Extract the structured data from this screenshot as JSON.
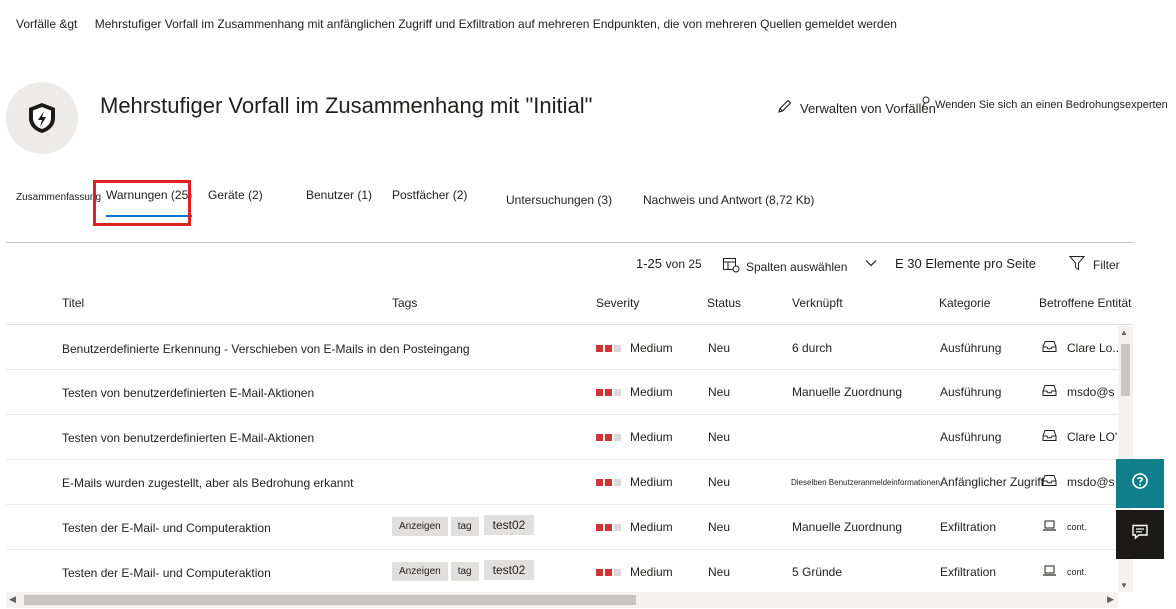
{
  "breadcrumb": {
    "root": "Vorfälle &gt",
    "current": "Mehrstufiger Vorfall im Zusammenhang mit anfänglichen Zugriff und Exfiltration auf mehreren Endpunkten, die von mehreren Quellen gemeldet werden"
  },
  "header": {
    "title": "Mehrstufiger Vorfall im Zusammenhang mit \"Initial\"",
    "icon": "shield-lightning-icon",
    "manage_label": "Verwalten von Vorfällen",
    "expert_label": "Wenden Sie sich an einen Bedrohungsexperten"
  },
  "tabs": [
    {
      "label": "Zusammenfassung"
    },
    {
      "label": "Warnungen (25)",
      "selected": true
    },
    {
      "label": "Geräte (2)"
    },
    {
      "label": "Benutzer (1)"
    },
    {
      "label": "Postfächer (2)"
    },
    {
      "label": "Untersuchungen (3)"
    },
    {
      "label": "Nachweis und Antwort (8,72 Kb)"
    }
  ],
  "toolbar": {
    "range": "1-25",
    "of_total": "von 25",
    "columns_label": "Spalten auswählen",
    "per_page": "E 30 Elemente pro Seite",
    "filter_label": "Filter"
  },
  "columns": {
    "title": "Titel",
    "tags": "Tags",
    "severity": "Severity",
    "status": "Status",
    "linked": "Verknüpft",
    "category": "Kategorie",
    "entities": "Betroffene Entität"
  },
  "rows": [
    {
      "title": "Benutzerdefinierte Erkennung - Verschieben von E-Mails in den Posteingang",
      "tags": [],
      "severity": "Medium",
      "severity_level": 2,
      "status": "Neu",
      "linked": "6 durch",
      "linked_small": false,
      "category": "Ausführung",
      "entity_icon": "mailbox-icon",
      "entity": "Clare Lo..."
    },
    {
      "title": "Testen von benutzerdefinierten E-Mail-Aktionen",
      "tags": [],
      "severity": "Medium",
      "severity_level": 2,
      "status": "Neu",
      "linked": "Manuelle Zuordnung",
      "linked_small": false,
      "category": "Ausführung",
      "entity_icon": "mailbox-icon",
      "entity": "msdo@s"
    },
    {
      "title": "Testen von benutzerdefinierten E-Mail-Aktionen",
      "tags": [],
      "severity": "Medium",
      "severity_level": 2,
      "status": "Neu",
      "linked": "",
      "linked_small": false,
      "category": "Ausführung",
      "entity_icon": "mailbox-icon",
      "entity": "Clare LO'"
    },
    {
      "title": "E-Mails wurden zugestellt, aber als Bedrohung erkannt",
      "tags": [],
      "severity": "Medium",
      "severity_level": 2,
      "status": "Neu",
      "linked": "Dieselben Benutzeranmeldeinformationen",
      "linked_small": true,
      "category": "Anfänglicher Zugriff",
      "entity_icon": "mailbox-icon",
      "entity": "msdo@s"
    },
    {
      "title": "Testen der E-Mail- und Computeraktion",
      "tags": [
        "Anzeigen",
        "tag",
        "test02"
      ],
      "severity": "Medium",
      "severity_level": 2,
      "status": "Neu",
      "linked": "Manuelle Zuordnung",
      "linked_small": false,
      "category": "Exfiltration",
      "entity_icon": "laptop-icon",
      "entity": "cont."
    },
    {
      "title": "Testen der E-Mail- und Computeraktion",
      "tags": [
        "Anzeigen",
        "tag",
        "test02"
      ],
      "severity": "Medium",
      "severity_level": 2,
      "status": "Neu",
      "linked": "5 Gründe",
      "linked_small": false,
      "category": "Exfiltration",
      "entity_icon": "laptop-icon",
      "entity": "cont."
    }
  ],
  "colors": {
    "accent": "#0078d4",
    "highlight": "#e02020",
    "severity": "#d13438",
    "help_button": "#0f7f8c",
    "chat_button": "#1b1a19"
  },
  "side_buttons": {
    "help": "help-icon",
    "chat": "feedback-chat-icon"
  }
}
